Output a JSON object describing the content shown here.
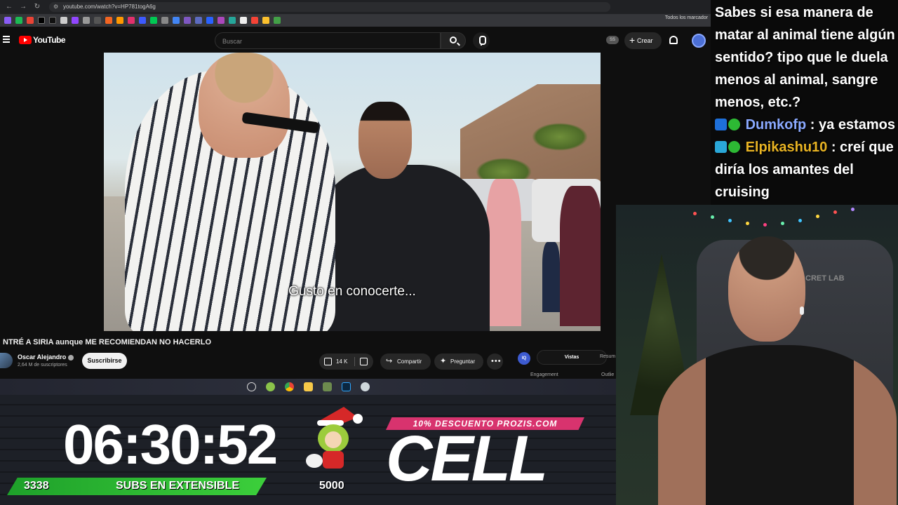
{
  "browser": {
    "url": "youtube.com/watch?v=HP781togA6g",
    "all_bookmarks_label": "Todos los marcador"
  },
  "youtube": {
    "logo_text": "YouTube",
    "search_placeholder": "Buscar",
    "account_badge": "SS",
    "create_label": "Crear"
  },
  "video": {
    "subtitle": "Gusto en conocerte...",
    "title": "NTRÉ A SIRIA aunque ME RECOMIENDAN NO HACERLO",
    "channel_name": "Oscar Alejandro",
    "subscriber_count": "2,64 M de suscriptores",
    "subscribe_label": "Suscribirse",
    "likes": "14 K",
    "share_label": "Compartir",
    "ask_label": "Preguntar",
    "more_label": "•••"
  },
  "side_panel": {
    "badge": "IQ",
    "tab_active": "Vistas",
    "tab_other": "Resum",
    "label_left": "Engagement",
    "label_right": "Outlie"
  },
  "overlay": {
    "timer": "06:30:52",
    "subs_current": "3338",
    "subs_text": "SUBS EN EXTENSIBLE",
    "subs_goal": "5000",
    "promo": "10% DESCUENTO PROZIS.COM",
    "brand": "CELL"
  },
  "chat": {
    "message_1": "Sabes si esa manera de matar al animal tiene algún sentido? tipo que le duela menos al animal, sangre menos, etc.?",
    "user_2": "Dumkofp",
    "message_2": ": ya estamos",
    "user_3": "Elpikashu10",
    "message_3": ": creí que diría los amantes del cruising"
  },
  "webcam": {
    "chair_brand": "CRET LAB"
  },
  "colors": {
    "youtube_red": "#ff0000",
    "subs_bar_green": "#2db934",
    "promo_pink": "#d8336e",
    "chat_nick_blue": "#8aa9ff",
    "chat_nick_gold": "#e8b323"
  }
}
